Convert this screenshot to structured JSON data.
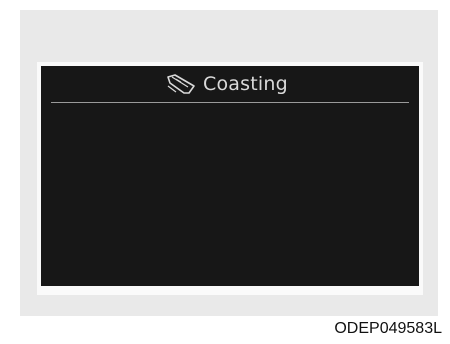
{
  "display": {
    "title": "Coasting",
    "icon": "coasting-icon"
  },
  "caption": "ODEP049583L"
}
